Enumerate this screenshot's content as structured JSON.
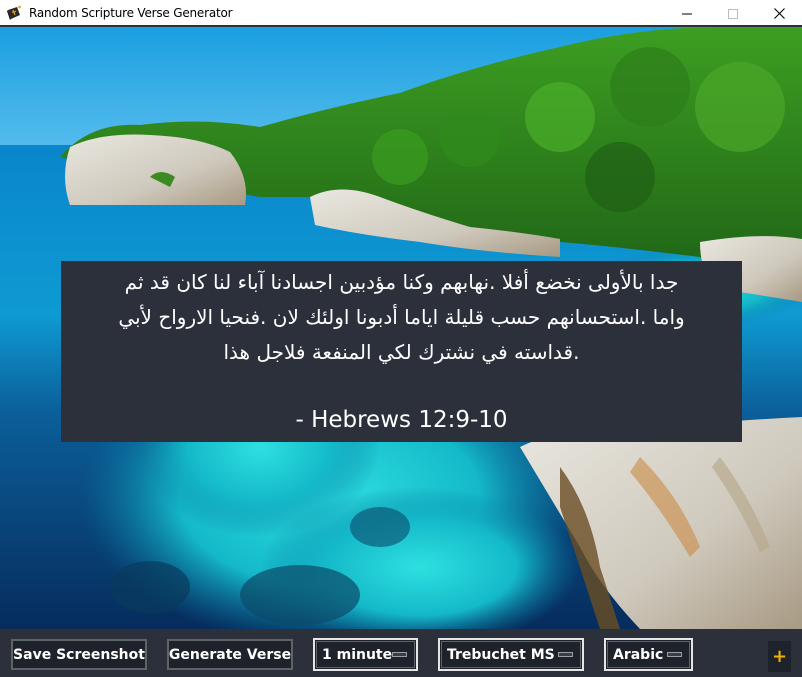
{
  "window": {
    "title": "Random Scripture Verse Generator",
    "icon": "bible-book-icon",
    "controls": {
      "minimize": "minimize-icon",
      "maximize": "maximize-icon",
      "close": "close-icon"
    }
  },
  "background": {
    "description": "Coastal cliff with pine trees over turquoise sea"
  },
  "verse": {
    "lines": [
      "جدا بالأولى نخضع أفلا .نهابهم وكنا مؤدبين اجسادنا آباء لنا كان قد ثم",
      "واما .استحسانهم حسب قليلة اياما أدبونا اولئك لان .فنحيا الارواح لأبي",
      ".قداسته في نشترك لكي المنفعة فلاجل هذا"
    ],
    "reference": "- Hebrews 12:9-10"
  },
  "toolbar": {
    "save_label": "Save Screenshot",
    "generate_label": "Generate Verse",
    "interval_selected": "1 minute",
    "font_selected": "Trebuchet MS",
    "language_selected": "Arabic",
    "plus_label": "+"
  },
  "colors": {
    "panel_bg": "#2b303b",
    "button_bg": "#1e222a",
    "accent_plus": "#f0b400",
    "text": "#ffffff"
  }
}
